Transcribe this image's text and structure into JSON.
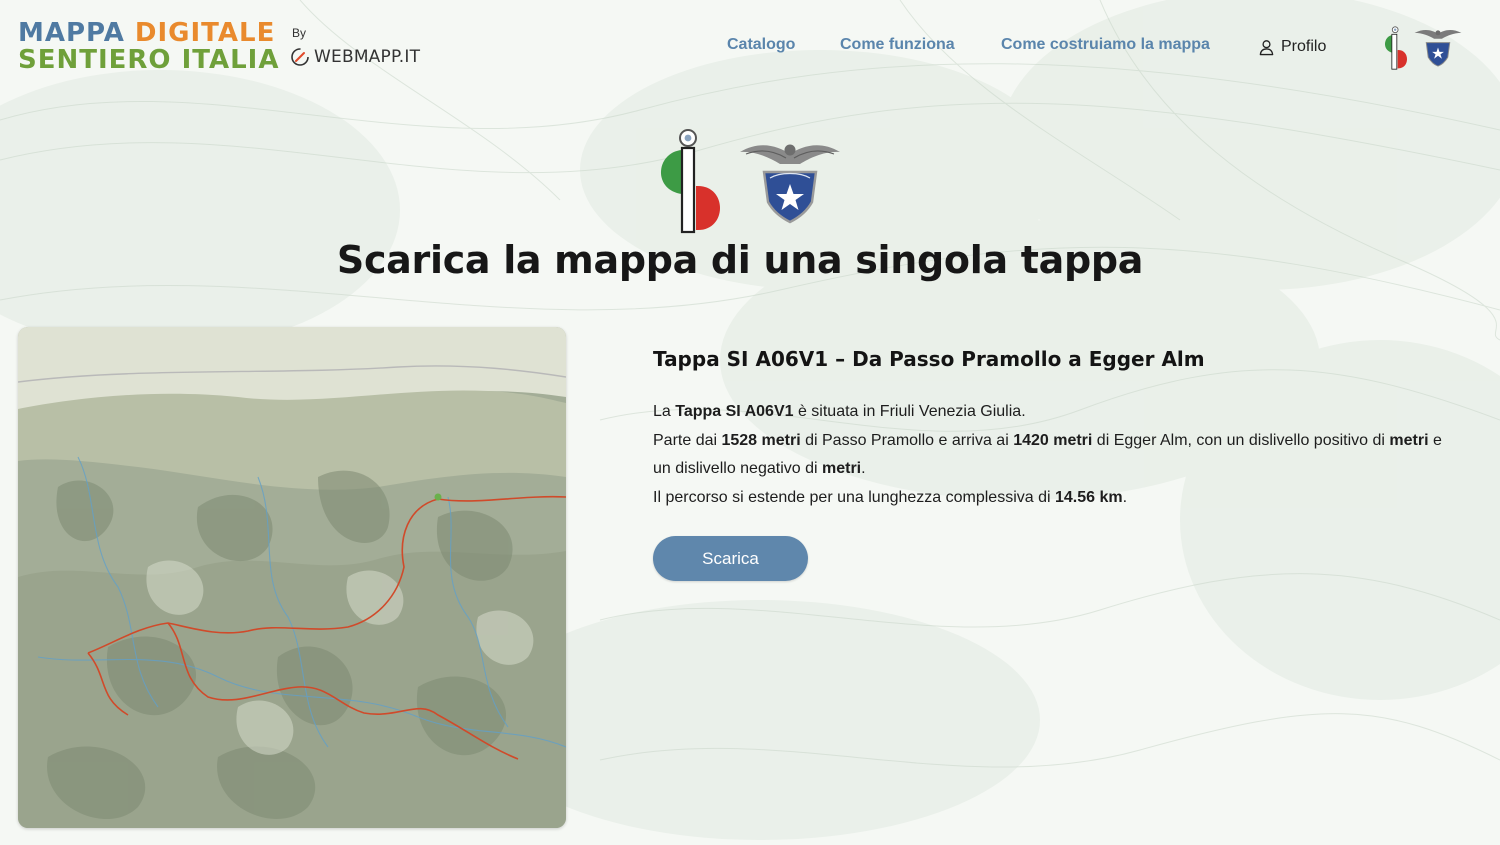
{
  "brand": {
    "title_word1": "MAPPA",
    "title_word2": "DIGITALE",
    "title_line2": "SENTIERO ITALIA",
    "by_label": "By",
    "by_brand": "WEBMAPP.IT",
    "colors": {
      "blue": "#4f7aa2",
      "orange": "#e98a2d",
      "green": "#6fa03a"
    }
  },
  "nav": {
    "items": [
      {
        "label": "Catalogo"
      },
      {
        "label": "Come funziona"
      },
      {
        "label": "Come costruiamo la mappa"
      }
    ],
    "profile_label": "Profilo",
    "profile_icon": "user-icon",
    "link_color": "#5a85ac"
  },
  "hero": {
    "title": "Scarica la mappa di una singola tappa",
    "logo_si_text": "i",
    "logo_cai_text": "CLUB ALPINO ITALIANO"
  },
  "stage": {
    "title": "Tappa SI A06V1 – Da Passo Pramollo a Egger Alm",
    "p1_pre": "La ",
    "p1_bold": "Tappa SI A06V1",
    "p1_post": " è situata in Friuli Venezia Giulia.",
    "p2_pre": "Parte dai ",
    "p2_b1": "1528 metri",
    "p2_mid1": " di Passo Pramollo e arriva ai ",
    "p2_b2": "1420 metri",
    "p2_mid2": " di Egger Alm, con un dislivello positivo di ",
    "p2_b3": "metri",
    "p2_mid3": " e un dislivello negativo di ",
    "p2_b4": "metri",
    "p2_end": ".",
    "p3_pre": "Il percorso si estende per una lunghezza complessiva di ",
    "p3_bold": "14.56 km",
    "p3_end": "."
  },
  "actions": {
    "download_label": "Scarica",
    "button_color": "#5f87ac"
  }
}
